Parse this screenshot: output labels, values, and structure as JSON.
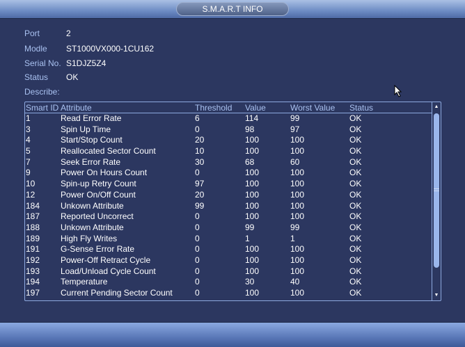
{
  "title": "S.M.A.R.T INFO",
  "info": {
    "port_label": "Port",
    "port": "2",
    "model_label": "Modle",
    "model": "ST1000VX000-1CU162",
    "serial_label": "Serial No.",
    "serial": "S1DJZ5Z4",
    "status_label": "Status",
    "status": "OK",
    "describe_label": "Describe:"
  },
  "table": {
    "headers": [
      "Smart ID",
      "Attribute",
      "Threshold",
      "Value",
      "Worst Value",
      "Status"
    ],
    "rows": [
      [
        "1",
        "Read Error Rate",
        "6",
        "114",
        "99",
        "OK"
      ],
      [
        "3",
        "Spin Up Time",
        "0",
        "98",
        "97",
        "OK"
      ],
      [
        "4",
        "Start/Stop Count",
        "20",
        "100",
        "100",
        "OK"
      ],
      [
        "5",
        "Reallocated Sector Count",
        "10",
        "100",
        "100",
        "OK"
      ],
      [
        "7",
        "Seek Error Rate",
        "30",
        "68",
        "60",
        "OK"
      ],
      [
        "9",
        "Power On Hours Count",
        "0",
        "100",
        "100",
        "OK"
      ],
      [
        "10",
        "Spin-up Retry Count",
        "97",
        "100",
        "100",
        "OK"
      ],
      [
        "12",
        "Power On/Off Count",
        "20",
        "100",
        "100",
        "OK"
      ],
      [
        "184",
        "Unkown Attribute",
        "99",
        "100",
        "100",
        "OK"
      ],
      [
        "187",
        "Reported Uncorrect",
        "0",
        "100",
        "100",
        "OK"
      ],
      [
        "188",
        "Unkown Attribute",
        "0",
        "99",
        "99",
        "OK"
      ],
      [
        "189",
        "High Fly Writes",
        "0",
        "1",
        "1",
        "OK"
      ],
      [
        "191",
        "G-Sense Error Rate",
        "0",
        "100",
        "100",
        "OK"
      ],
      [
        "192",
        "Power-Off Retract Cycle",
        "0",
        "100",
        "100",
        "OK"
      ],
      [
        "193",
        "Load/Unload Cycle Count",
        "0",
        "100",
        "100",
        "OK"
      ],
      [
        "194",
        "Temperature",
        "0",
        "30",
        "40",
        "OK"
      ],
      [
        "197",
        "Current Pending Sector Count",
        "0",
        "100",
        "100",
        "OK"
      ]
    ]
  }
}
